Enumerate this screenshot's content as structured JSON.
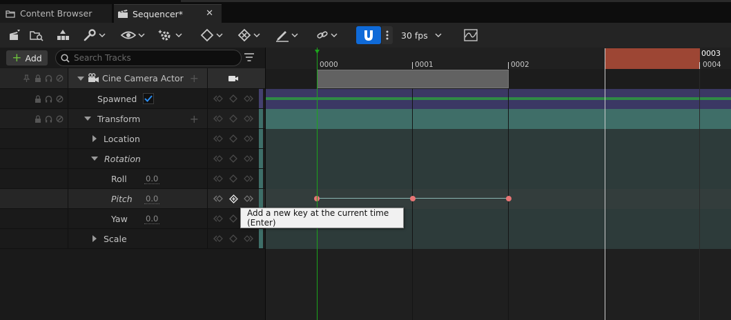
{
  "tabs": [
    {
      "label": "Content Browser",
      "icon": "content-browser-icon"
    },
    {
      "label": "Sequencer*",
      "icon": "clapperboard-icon"
    }
  ],
  "toolbar": {
    "fps_label": "30 fps"
  },
  "left": {
    "add_label": "Add",
    "search_placeholder": "Search Tracks"
  },
  "tracks": [
    {
      "label": "Cine Camera Actor"
    },
    {
      "label": "Spawned",
      "checked": true
    },
    {
      "label": "Transform"
    },
    {
      "label": "Location"
    },
    {
      "label": "Rotation"
    },
    {
      "label": "Roll",
      "value": "0.0"
    },
    {
      "label": "Pitch",
      "value": "0.0"
    },
    {
      "label": "Yaw",
      "value": "0.0"
    },
    {
      "label": "Scale"
    }
  ],
  "timeline": {
    "ticks": [
      "0000",
      "0001",
      "0002",
      "0003",
      "0004"
    ],
    "playhead_frame": "0000",
    "end_frame_label": "0003"
  },
  "tooltip": "Add a new key at the current time (Enter)",
  "colors": {
    "accent": "#0f6ad8",
    "playhead": "#1ca51c",
    "end_marker": "#9d4634",
    "key": "#e87575",
    "spawned_lane": "#3b3864",
    "transform_lane": "#3f6e68"
  }
}
